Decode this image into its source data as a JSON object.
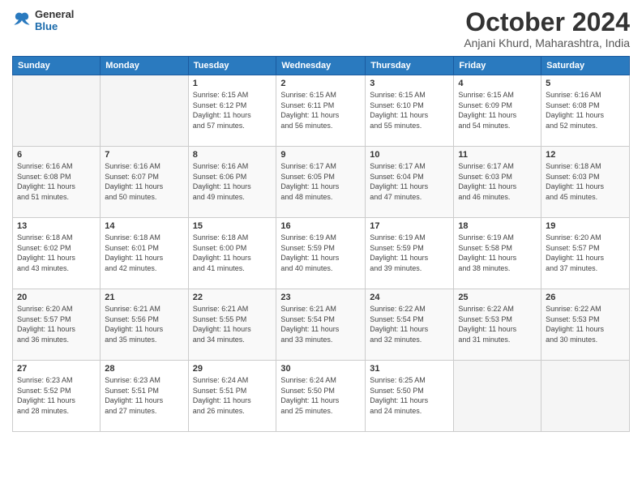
{
  "header": {
    "logo_line1": "General",
    "logo_line2": "Blue",
    "month": "October 2024",
    "location": "Anjani Khurd, Maharashtra, India"
  },
  "weekdays": [
    "Sunday",
    "Monday",
    "Tuesday",
    "Wednesday",
    "Thursday",
    "Friday",
    "Saturday"
  ],
  "weeks": [
    [
      {
        "day": "",
        "info": ""
      },
      {
        "day": "",
        "info": ""
      },
      {
        "day": "1",
        "info": "Sunrise: 6:15 AM\nSunset: 6:12 PM\nDaylight: 11 hours\nand 57 minutes."
      },
      {
        "day": "2",
        "info": "Sunrise: 6:15 AM\nSunset: 6:11 PM\nDaylight: 11 hours\nand 56 minutes."
      },
      {
        "day": "3",
        "info": "Sunrise: 6:15 AM\nSunset: 6:10 PM\nDaylight: 11 hours\nand 55 minutes."
      },
      {
        "day": "4",
        "info": "Sunrise: 6:15 AM\nSunset: 6:09 PM\nDaylight: 11 hours\nand 54 minutes."
      },
      {
        "day": "5",
        "info": "Sunrise: 6:16 AM\nSunset: 6:08 PM\nDaylight: 11 hours\nand 52 minutes."
      }
    ],
    [
      {
        "day": "6",
        "info": "Sunrise: 6:16 AM\nSunset: 6:08 PM\nDaylight: 11 hours\nand 51 minutes."
      },
      {
        "day": "7",
        "info": "Sunrise: 6:16 AM\nSunset: 6:07 PM\nDaylight: 11 hours\nand 50 minutes."
      },
      {
        "day": "8",
        "info": "Sunrise: 6:16 AM\nSunset: 6:06 PM\nDaylight: 11 hours\nand 49 minutes."
      },
      {
        "day": "9",
        "info": "Sunrise: 6:17 AM\nSunset: 6:05 PM\nDaylight: 11 hours\nand 48 minutes."
      },
      {
        "day": "10",
        "info": "Sunrise: 6:17 AM\nSunset: 6:04 PM\nDaylight: 11 hours\nand 47 minutes."
      },
      {
        "day": "11",
        "info": "Sunrise: 6:17 AM\nSunset: 6:03 PM\nDaylight: 11 hours\nand 46 minutes."
      },
      {
        "day": "12",
        "info": "Sunrise: 6:18 AM\nSunset: 6:03 PM\nDaylight: 11 hours\nand 45 minutes."
      }
    ],
    [
      {
        "day": "13",
        "info": "Sunrise: 6:18 AM\nSunset: 6:02 PM\nDaylight: 11 hours\nand 43 minutes."
      },
      {
        "day": "14",
        "info": "Sunrise: 6:18 AM\nSunset: 6:01 PM\nDaylight: 11 hours\nand 42 minutes."
      },
      {
        "day": "15",
        "info": "Sunrise: 6:18 AM\nSunset: 6:00 PM\nDaylight: 11 hours\nand 41 minutes."
      },
      {
        "day": "16",
        "info": "Sunrise: 6:19 AM\nSunset: 5:59 PM\nDaylight: 11 hours\nand 40 minutes."
      },
      {
        "day": "17",
        "info": "Sunrise: 6:19 AM\nSunset: 5:59 PM\nDaylight: 11 hours\nand 39 minutes."
      },
      {
        "day": "18",
        "info": "Sunrise: 6:19 AM\nSunset: 5:58 PM\nDaylight: 11 hours\nand 38 minutes."
      },
      {
        "day": "19",
        "info": "Sunrise: 6:20 AM\nSunset: 5:57 PM\nDaylight: 11 hours\nand 37 minutes."
      }
    ],
    [
      {
        "day": "20",
        "info": "Sunrise: 6:20 AM\nSunset: 5:57 PM\nDaylight: 11 hours\nand 36 minutes."
      },
      {
        "day": "21",
        "info": "Sunrise: 6:21 AM\nSunset: 5:56 PM\nDaylight: 11 hours\nand 35 minutes."
      },
      {
        "day": "22",
        "info": "Sunrise: 6:21 AM\nSunset: 5:55 PM\nDaylight: 11 hours\nand 34 minutes."
      },
      {
        "day": "23",
        "info": "Sunrise: 6:21 AM\nSunset: 5:54 PM\nDaylight: 11 hours\nand 33 minutes."
      },
      {
        "day": "24",
        "info": "Sunrise: 6:22 AM\nSunset: 5:54 PM\nDaylight: 11 hours\nand 32 minutes."
      },
      {
        "day": "25",
        "info": "Sunrise: 6:22 AM\nSunset: 5:53 PM\nDaylight: 11 hours\nand 31 minutes."
      },
      {
        "day": "26",
        "info": "Sunrise: 6:22 AM\nSunset: 5:53 PM\nDaylight: 11 hours\nand 30 minutes."
      }
    ],
    [
      {
        "day": "27",
        "info": "Sunrise: 6:23 AM\nSunset: 5:52 PM\nDaylight: 11 hours\nand 28 minutes."
      },
      {
        "day": "28",
        "info": "Sunrise: 6:23 AM\nSunset: 5:51 PM\nDaylight: 11 hours\nand 27 minutes."
      },
      {
        "day": "29",
        "info": "Sunrise: 6:24 AM\nSunset: 5:51 PM\nDaylight: 11 hours\nand 26 minutes."
      },
      {
        "day": "30",
        "info": "Sunrise: 6:24 AM\nSunset: 5:50 PM\nDaylight: 11 hours\nand 25 minutes."
      },
      {
        "day": "31",
        "info": "Sunrise: 6:25 AM\nSunset: 5:50 PM\nDaylight: 11 hours\nand 24 minutes."
      },
      {
        "day": "",
        "info": ""
      },
      {
        "day": "",
        "info": ""
      }
    ]
  ]
}
